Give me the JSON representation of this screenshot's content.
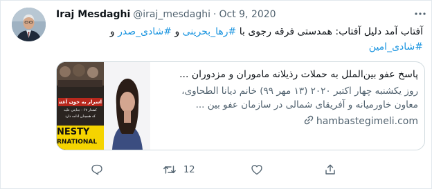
{
  "author": {
    "name": "Iraj Mesdaghi",
    "handle": "@iraj_mesdaghi",
    "separator": "·",
    "date": "Oct 9, 2020"
  },
  "tweet": {
    "text_part1": "آفتاب آمد دلیل آفتاب: همدستی فرقه رجوی با ",
    "hashtag1": "#رها_بحرینی",
    "text_part2": " و ",
    "hashtag2": "#شادی_صدر",
    "text_part3": " و ",
    "hashtag3": "#شادی_امین"
  },
  "card": {
    "title": "پاسخ عفو بین‌الملل به حملات رذیلانه ماموران و مزدوران ...",
    "description": "روز یکشنبه چهار اکتبر ۲۰۲۰ (۱۳ مهر ۹۹) خانم دیانا الطحاوی، معاون خاورمیانه و آفریقای شمالی در سازمان عفو بین ...",
    "domain": "hambastegimeli.com",
    "image": {
      "poster_line1": "اسرار به خون آغشته",
      "poster_line2": "کشتار ۶۷ - جنایتی علیه",
      "poster_line3": "که همچنان ادامه دارد",
      "banner_line1": "NESTY",
      "banner_line2": "RNATIONAL"
    }
  },
  "actions": {
    "reply_icon": "reply-icon",
    "retweet_icon": "retweet-icon",
    "retweet_count": "12",
    "like_icon": "heart-icon",
    "share_icon": "share-icon"
  },
  "colors": {
    "link": "#1b95e0",
    "secondary_text": "#536471",
    "border": "#cfd9de",
    "amnesty_yellow": "#f5d400"
  }
}
